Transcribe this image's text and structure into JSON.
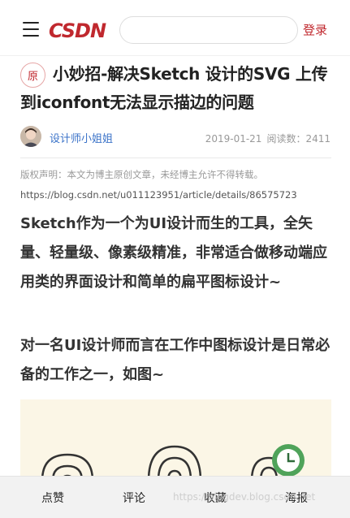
{
  "header": {
    "logo_text": "CSDN",
    "search_placeholder": "",
    "login_label": "登录",
    "brand_color": "#c0282e"
  },
  "article": {
    "original_badge": "原",
    "title": "小妙招-解决Sketch 设计的SVG 上传到iconfont无法显示描边的问题",
    "author": "设计师小姐姐",
    "date": "2019-01-21",
    "reads": "阅读数：2411",
    "copyright": "版权声明：本文为博主原创文章，未经博主允许不得转载。",
    "source_url": "https://blog.csdn.net/u011123951/article/details/86575723",
    "paragraphs": [
      "Sketch作为一个为UI设计而生的工具，全矢量、轻量级、像素级精准，非常适合做移动端应用类的界面设计和简单的扁平图标设计~",
      "对一名UI设计师而言在工作中图标设计是日常必备的工作之一，如图~"
    ]
  },
  "bottom_bar": {
    "like": "点赞",
    "comment": "评论",
    "favorite": "收藏",
    "poster": "海报"
  },
  "watermark": "https://blogdev.blog.csdn.net"
}
